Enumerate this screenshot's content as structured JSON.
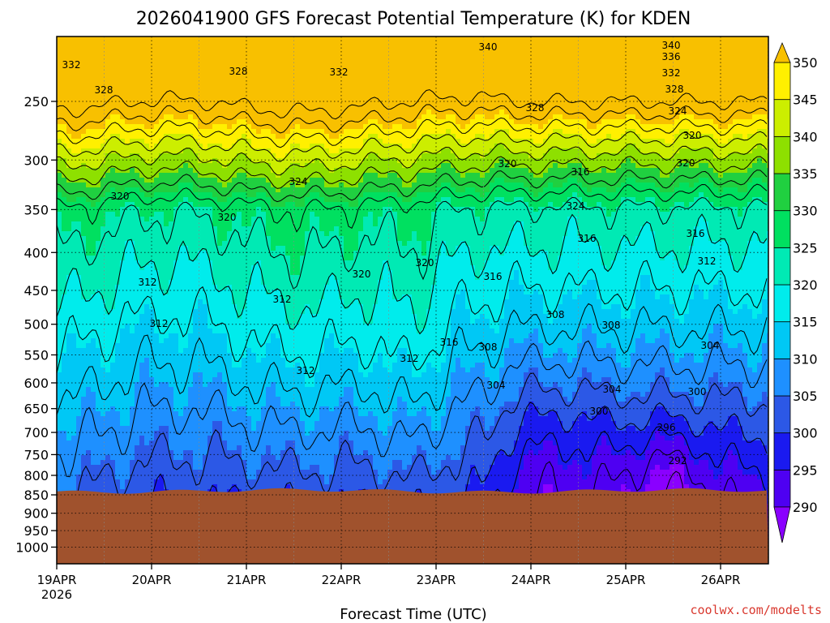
{
  "chart_data": {
    "type": "heatmap",
    "title": "2026041900 GFS Forecast Potential Temperature (K) for KDEN",
    "xlabel": "Forecast Time (UTC)",
    "ylabel": "",
    "credit": "coolwx.com/modelts",
    "x_ticks": [
      "19APR",
      "20APR",
      "21APR",
      "22APR",
      "23APR",
      "24APR",
      "25APR",
      "26APR"
    ],
    "x_start_year": "2026",
    "xlim": [
      "2026-04-19T00",
      "2026-04-26T12"
    ],
    "y_ticks": [
      250,
      300,
      350,
      400,
      450,
      500,
      550,
      600,
      650,
      700,
      750,
      800,
      850,
      900,
      950,
      1000
    ],
    "ylim": [
      1050,
      200
    ],
    "y_scale": "log-pressure",
    "surface_pressure": 840,
    "grid": true,
    "colorbar": {
      "levels": [
        290,
        295,
        300,
        305,
        310,
        315,
        320,
        325,
        330,
        335,
        340,
        345,
        350
      ],
      "colors": [
        "#8a00ff",
        "#4e00f2",
        "#1a1af0",
        "#2c58e6",
        "#1e90ff",
        "#00c8f5",
        "#00ecec",
        "#00eab4",
        "#00e060",
        "#20d040",
        "#8ee000",
        "#ccee00",
        "#fff000",
        "#f8c000"
      ],
      "labels": [
        "290",
        "295",
        "300",
        "305",
        "310",
        "315",
        "320",
        "325",
        "330",
        "335",
        "340",
        "345",
        "350"
      ],
      "placement": "right"
    },
    "contour_labels": [
      "332",
      "328",
      "328",
      "332",
      "340",
      "340",
      "336",
      "332",
      "328",
      "328",
      "324",
      "320",
      "324",
      "320",
      "316",
      "320",
      "320",
      "320",
      "324",
      "316",
      "316",
      "312",
      "312",
      "312",
      "320",
      "320",
      "316",
      "316",
      "312",
      "312",
      "312",
      "308",
      "308",
      "308",
      "304",
      "304",
      "304",
      "300",
      "300",
      "296",
      "292"
    ]
  }
}
